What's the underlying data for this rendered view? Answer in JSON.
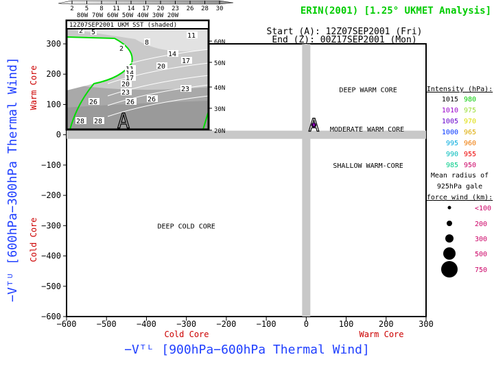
{
  "title": "ERIN(2001) [1.25° UKMET Analysis]",
  "start_label": "Start (A): 12Z07SEP2001 (Fri)",
  "end_label": "End (Z): 00Z17SEP2001 (Mon)",
  "colors": {
    "title": "#00cc00",
    "axis_title": "#1f3fff",
    "core_label": "#cc0000",
    "gridband": "#c8c8c8",
    "coast": "#00dd00",
    "marker_fill": "#9900cc",
    "size_label": "#cc0066"
  },
  "inset": {
    "title": "12Z07SEP2001 UKM SST (shaded)",
    "colorbar_ticks": [
      "2",
      "5",
      "8",
      "11",
      "14",
      "17",
      "20",
      "23",
      "26",
      "28",
      "30"
    ],
    "lon_labels": [
      "80W",
      "70W",
      "60W",
      "50W",
      "40W",
      "30W",
      "20W"
    ],
    "lat_labels": [
      "60N",
      "50N",
      "40N",
      "30N",
      "20N"
    ],
    "contour_labels": [
      "2",
      "5",
      "8",
      "11",
      "14",
      "17",
      "20",
      "23",
      "26",
      "26",
      "26",
      "28",
      "28",
      "2",
      "11",
      "14",
      "17",
      "20",
      "23"
    ],
    "marker_label": "A"
  },
  "legend": {
    "intensity_title": "Intensity (hPa):",
    "intensity_rows": [
      {
        "left": "1015",
        "left_color": "#000000",
        "right": "980",
        "right_color": "#00cc00"
      },
      {
        "left": "1010",
        "left_color": "#9900cc",
        "right": "975",
        "right_color": "#99dd33"
      },
      {
        "left": "1005",
        "left_color": "#6600cc",
        "right": "970",
        "right_color": "#dddd00"
      },
      {
        "left": "1000",
        "left_color": "#0033ff",
        "right": "965",
        "right_color": "#ddaa00"
      },
      {
        "left": "995",
        "left_color": "#00aadd",
        "right": "960",
        "right_color": "#ee7700"
      },
      {
        "left": "990",
        "left_color": "#00bbbb",
        "right": "955",
        "right_color": "#ee0000"
      },
      {
        "left": "985",
        "left_color": "#00cc88",
        "right": "950",
        "right_color": "#cc0066"
      }
    ],
    "radius_title_1": "Mean radius of",
    "radius_title_2": "925hPa gale",
    "radius_title_3": "force wind (km):",
    "radius_rows": [
      "<100",
      "200",
      "300",
      "500",
      "750"
    ]
  },
  "chart_data": {
    "type": "scatter",
    "title": "ERIN(2001) [1.25° UKMET Analysis]",
    "xlabel": "-V_T^L [900hPa-600hPa Thermal Wind]",
    "ylabel": "-V_T^U [600hPa-300hPa Thermal Wind]",
    "xlim": [
      -600,
      300
    ],
    "ylim": [
      -600,
      300
    ],
    "xticks": [
      -600,
      -500,
      -400,
      -300,
      -200,
      -100,
      0,
      100,
      200,
      300
    ],
    "yticks": [
      300,
      200,
      100,
      0,
      -100,
      -200,
      -300,
      -400,
      -500,
      -600
    ],
    "x_low_label": "Cold Core",
    "x_high_label": "Warm Core",
    "y_low_label": "Cold Core",
    "y_high_label": "Warm Core",
    "region_labels": [
      {
        "text": "DEEP WARM CORE",
        "x": 155,
        "y": 150
      },
      {
        "text": "MODERATE WARM CORE",
        "x": 155,
        "y": 20
      },
      {
        "text": "SHALLOW WARM-CORE",
        "x": 155,
        "y": -100
      },
      {
        "text": "DEEP COLD CORE",
        "x": -300,
        "y": -300
      }
    ],
    "points": [
      {
        "label": "A",
        "x": 19,
        "y": 32,
        "intensity_hPa": 1010,
        "radius_km": "<100"
      }
    ],
    "grid": false,
    "zero_lines": true
  }
}
